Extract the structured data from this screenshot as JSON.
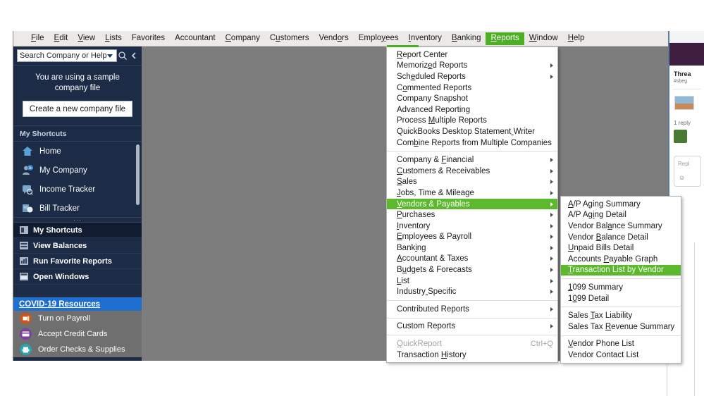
{
  "app": {
    "name": "QuickBooks Desktop"
  },
  "menubar": {
    "items": [
      {
        "label": "File",
        "accel_index": 0,
        "active": false
      },
      {
        "label": "Edit",
        "accel_index": 0,
        "active": false
      },
      {
        "label": "View",
        "accel_index": 0,
        "active": false
      },
      {
        "label": "Lists",
        "accel_index": 0,
        "active": false
      },
      {
        "label": "Favorites",
        "accel_index": -1,
        "active": false
      },
      {
        "label": "Accountant",
        "accel_index": -1,
        "active": false
      },
      {
        "label": "Company",
        "accel_index": 0,
        "active": false
      },
      {
        "label": "Customers",
        "accel_index": 1,
        "active": false
      },
      {
        "label": "Vendors",
        "accel_index": 4,
        "active": false
      },
      {
        "label": "Employees",
        "accel_index": 5,
        "active": false
      },
      {
        "label": "Inventory",
        "accel_index": 0,
        "active": false
      },
      {
        "label": "Banking",
        "accel_index": 0,
        "active": false
      },
      {
        "label": "Reports",
        "accel_index": 0,
        "active": true
      },
      {
        "label": "Window",
        "accel_index": 0,
        "active": false
      },
      {
        "label": "Help",
        "accel_index": 0,
        "active": false
      }
    ]
  },
  "sidebar": {
    "search": {
      "placeholder": "Search Company or Help",
      "value": "",
      "search_icon": "magnifier-icon",
      "dropdown_icon": "caret-down-icon",
      "collapse_icon": "chevron-left-icon"
    },
    "sample_panel": {
      "line1": "You are using a sample",
      "line2": "company file",
      "button_label": "Create a new company file"
    },
    "shortcuts_header": "My Shortcuts",
    "shortcuts": [
      {
        "label": "Home",
        "icon": "home-icon"
      },
      {
        "label": "My Company",
        "icon": "company-person-icon"
      },
      {
        "label": "Income Tracker",
        "icon": "income-tracker-icon"
      },
      {
        "label": "Bill Tracker",
        "icon": "bill-tracker-icon"
      }
    ],
    "panels": [
      {
        "label": "My Shortcuts",
        "icon": "shortcuts-panel-icon"
      },
      {
        "label": "View Balances",
        "icon": "balances-panel-icon"
      },
      {
        "label": "Run Favorite Reports",
        "icon": "favorite-reports-icon"
      },
      {
        "label": "Open Windows",
        "icon": "open-windows-icon"
      }
    ],
    "covid_link": "COVID-19 Resources",
    "bottom_links": [
      {
        "label": "Turn on Payroll",
        "icon": "payroll-icon",
        "color": "#c8561e"
      },
      {
        "label": "Accept Credit Cards",
        "icon": "credit-card-icon",
        "color": "#7b3fa0"
      },
      {
        "label": "Order Checks & Supplies",
        "icon": "checks-supplies-icon",
        "color": "#2aa3ad"
      }
    ]
  },
  "reports_menu": {
    "groups": [
      {
        "items": [
          {
            "label": "Report Center",
            "accel_index": 0,
            "submenu": false
          },
          {
            "label": "Memorized Reports",
            "accel_index": 7,
            "submenu": true
          },
          {
            "label": "Scheduled Reports",
            "accel_index": 3,
            "submenu": true
          },
          {
            "label": "Commented Reports",
            "accel_index": 1,
            "submenu": false
          },
          {
            "label": "Company Snapshot",
            "accel_index": -1,
            "submenu": false
          },
          {
            "label": "Advanced Reporting",
            "accel_index": -1,
            "submenu": false
          },
          {
            "label": "Process Multiple Reports",
            "accel_index": 8,
            "submenu": false
          },
          {
            "label": "QuickBooks Desktop Statement Writer",
            "accel_index": 28,
            "submenu": false
          },
          {
            "label": "Combine Reports from Multiple Companies",
            "accel_index": 3,
            "submenu": false
          }
        ]
      },
      {
        "items": [
          {
            "label": "Company & Financial",
            "accel_index": 10,
            "submenu": true
          },
          {
            "label": "Customers & Receivables",
            "accel_index": 0,
            "submenu": true
          },
          {
            "label": "Sales",
            "accel_index": 0,
            "submenu": true
          },
          {
            "label": "Jobs, Time & Mileage",
            "accel_index": 0,
            "submenu": true
          },
          {
            "label": "Vendors & Payables",
            "accel_index": 0,
            "submenu": true,
            "selected": true
          },
          {
            "label": "Purchases",
            "accel_index": 0,
            "submenu": true
          },
          {
            "label": "Inventory",
            "accel_index": 0,
            "submenu": true
          },
          {
            "label": "Employees & Payroll",
            "accel_index": 0,
            "submenu": true
          },
          {
            "label": "Banking",
            "accel_index": 4,
            "submenu": true
          },
          {
            "label": "Accountant & Taxes",
            "accel_index": 0,
            "submenu": true
          },
          {
            "label": "Budgets & Forecasts",
            "accel_index": 1,
            "submenu": true
          },
          {
            "label": "List",
            "accel_index": 0,
            "submenu": true
          },
          {
            "label": "Industry Specific",
            "accel_index": 8,
            "submenu": true
          }
        ]
      },
      {
        "items": [
          {
            "label": "Contributed Reports",
            "accel_index": -1,
            "submenu": true
          }
        ]
      },
      {
        "items": [
          {
            "label": "Custom Reports",
            "accel_index": -1,
            "submenu": true
          }
        ]
      },
      {
        "items": [
          {
            "label": "QuickReport",
            "accel_index": 0,
            "submenu": false,
            "disabled": true,
            "accel_text": "Ctrl+Q"
          },
          {
            "label": "Transaction History",
            "accel_index": 12,
            "submenu": false
          }
        ]
      }
    ]
  },
  "vendors_submenu": {
    "groups": [
      {
        "items": [
          {
            "label": "A/P Aging Summary",
            "accel_index": 0
          },
          {
            "label": "A/P Aging Detail",
            "accel_index": 6
          },
          {
            "label": "Vendor Balance Summary",
            "accel_index": 10
          },
          {
            "label": "Vendor Balance Detail",
            "accel_index": 7
          },
          {
            "label": "Unpaid Bills Detail",
            "accel_index": 0
          },
          {
            "label": "Accounts Payable Graph",
            "accel_index": 9
          },
          {
            "label": "Transaction List by Vendor",
            "accel_index": 0,
            "selected": true
          }
        ]
      },
      {
        "items": [
          {
            "label": "1099 Summary",
            "accel_index": 0
          },
          {
            "label": "1099 Detail",
            "accel_index": 1
          }
        ]
      },
      {
        "items": [
          {
            "label": "Sales Tax Liability",
            "accel_index": 6
          },
          {
            "label": "Sales Tax Revenue Summary",
            "accel_index": 10
          }
        ]
      },
      {
        "items": [
          {
            "label": "Vendor Phone List",
            "accel_index": 0
          },
          {
            "label": "Vendor Contact List",
            "accel_index": -1
          }
        ]
      }
    ]
  },
  "right_panel": {
    "title": "Threa",
    "channel": "#sbeg",
    "reply_count": "1 reply",
    "compose_placeholder": "Repl",
    "compose_icon": "emoji-icon",
    "photo_name": "thread-image-thumbnail",
    "avatar_name": "user-avatar"
  },
  "colors": {
    "menu_highlight": "#4caf24",
    "menu_item_selected": "#5cb82c",
    "sidebar_bg": "#1c2b46",
    "workarea_bg": "#7d7d7d",
    "covid_bg": "#1f6fd0"
  }
}
